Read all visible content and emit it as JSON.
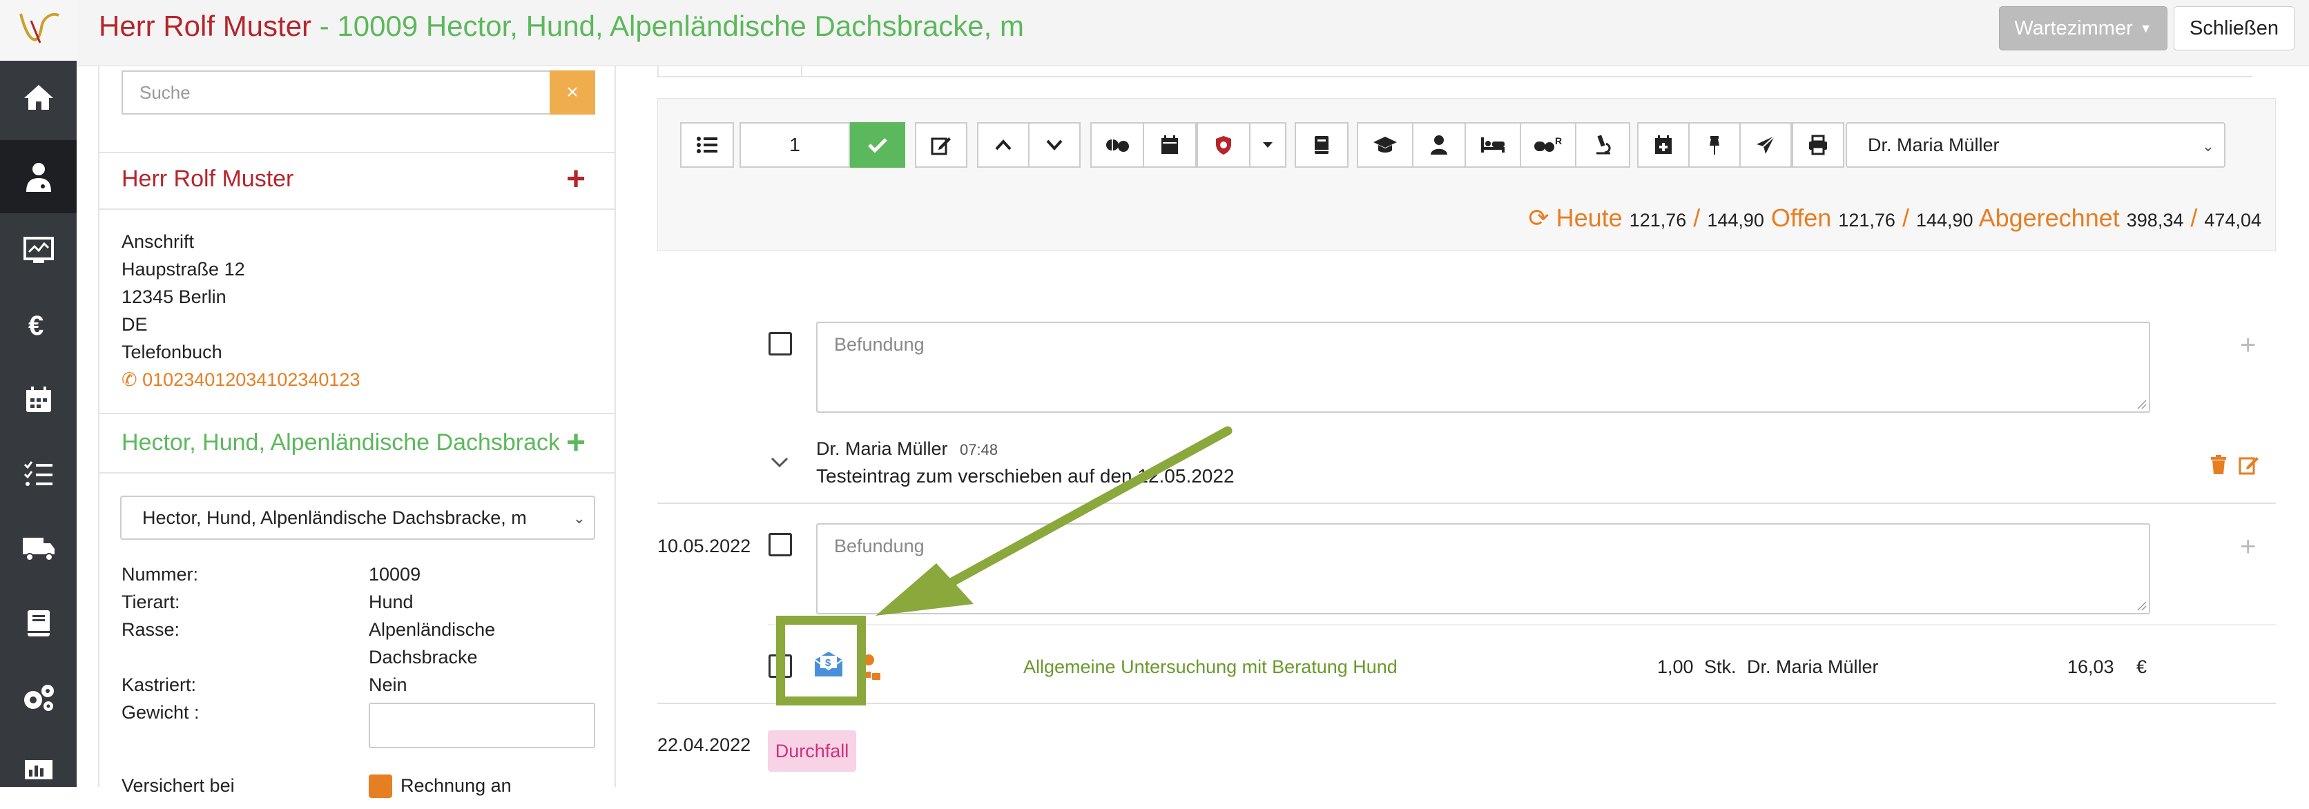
{
  "header": {
    "owner_name": "Herr Rolf Muster",
    "separator": " - ",
    "patient_title": "10009 Hector, Hund, Alpenländische Dachsbracke, m",
    "waiting_room_button": "Wartezimmer",
    "close_button": "Schließen"
  },
  "sidebar": {
    "items": [
      {
        "icon": "home-icon"
      },
      {
        "icon": "doctor-icon"
      },
      {
        "icon": "monitor-chart-icon"
      },
      {
        "icon": "euro-icon"
      },
      {
        "icon": "calendar-icon"
      },
      {
        "icon": "checklist-icon"
      },
      {
        "icon": "truck-icon"
      },
      {
        "icon": "book-icon"
      },
      {
        "icon": "cogs-icon"
      },
      {
        "icon": "screen-chart-icon"
      }
    ]
  },
  "left_panel": {
    "search_placeholder": "Suche",
    "search_clear": "×",
    "owner_section_title": "Herr Rolf Muster",
    "address_heading": "Anschrift",
    "street": "Haupstraße 12",
    "city": "12345  Berlin",
    "country": "DE",
    "phonebook_label": "Telefonbuch",
    "phone": "010234012034102340123",
    "patient_section_title": "Hector, Hund, Alpenländische Dachsbracke, m",
    "patient_select_value": "Hector, Hund, Alpenländische Dachsbracke, m",
    "fields": {
      "nummer_label": "Nummer:",
      "nummer_value": "10009",
      "tierart_label": "Tierart:",
      "tierart_value": "Hund",
      "rasse_label": "Rasse:",
      "rasse_value_line1": "Alpenländische",
      "rasse_value_line2": "Dachsbracke",
      "kastriert_label": "Kastriert:",
      "kastriert_value": "Nein",
      "gewicht_label": "Gewicht :",
      "versichert_label": "Versichert bei",
      "rechnung_label": "Rechnung an"
    }
  },
  "toolbar": {
    "count_value": "1",
    "doctor_select": "Dr. Maria Müller"
  },
  "totals": {
    "heute_label": "Heute",
    "heute_values": "121,76",
    "heute_total": "144,90",
    "offen_label": "Offen",
    "offen_values": "121,76",
    "offen_total": "144,90",
    "abgerechnet_label": "Abgerechnet",
    "abgerechnet_values": "398,34",
    "abgerechnet_total": "474,04",
    "slash": "/"
  },
  "entries": {
    "befund_placeholder": "Befundung",
    "note_author": "Dr. Maria Müller",
    "note_time": "07:48",
    "note_text": "Testeintrag zum verschieben auf den 12.05.2022",
    "date_1": "10.05.2022",
    "service_name": "Allgemeine Untersuchung mit Beratung Hund",
    "service_qty": "1,00",
    "service_unit": "Stk.",
    "service_doctor": "Dr. Maria Müller",
    "service_price": "16,03",
    "service_currency": "€",
    "date_2": "22.04.2022",
    "tag_label": "Durchfall"
  }
}
